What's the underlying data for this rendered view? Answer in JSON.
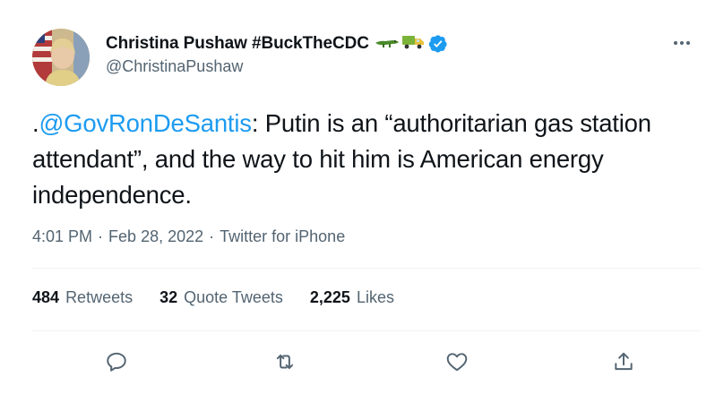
{
  "author": {
    "display_name": "Christina Pushaw #BuckTheCDC",
    "handle": "@ChristinaPushaw",
    "emoji_icons": [
      "alligator-icon",
      "truck-icon"
    ],
    "verified": true
  },
  "tweet": {
    "prefix": ".",
    "mention": "@GovRonDeSantis",
    "body": ": Putin is an “authoritarian gas station attendant”, and the way to hit him is American energy independence."
  },
  "meta": {
    "time": "4:01 PM",
    "date": "Feb 28, 2022",
    "source": "Twitter for iPhone",
    "separator": "·"
  },
  "stats": {
    "retweets_count": "484",
    "retweets_label": "Retweets",
    "quotes_count": "32",
    "quotes_label": "Quote Tweets",
    "likes_count": "2,225",
    "likes_label": "Likes"
  },
  "actions": [
    "reply-icon",
    "retweet-icon",
    "like-icon",
    "share-icon"
  ],
  "colors": {
    "accent": "#1d9bf0",
    "secondary_text": "#536471",
    "primary_text": "#0f1419",
    "divider": "#eff3f4"
  }
}
